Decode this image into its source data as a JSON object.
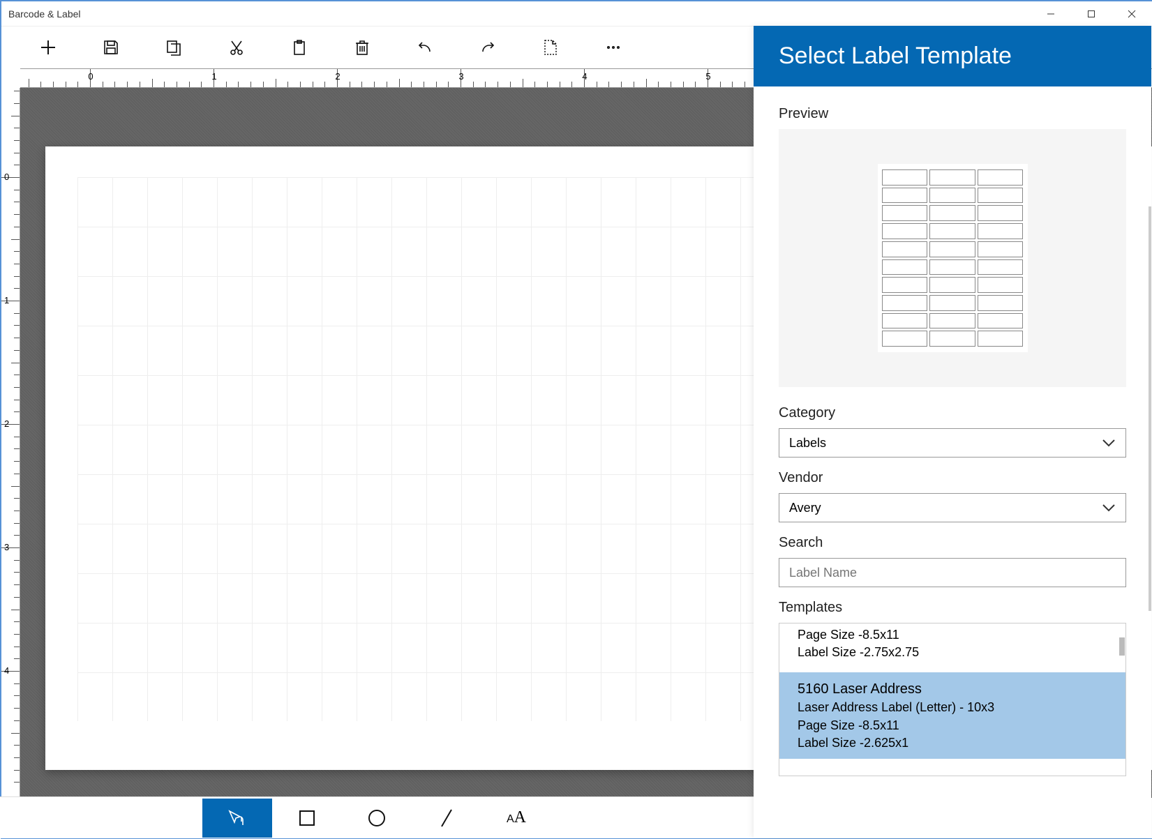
{
  "window": {
    "title": "Barcode & Label"
  },
  "toolbar": {
    "items": [
      "new",
      "save",
      "copy",
      "cut",
      "paste",
      "delete",
      "undo",
      "redo",
      "new-doc",
      "more"
    ]
  },
  "ruler": {
    "majors": [
      0,
      1,
      2,
      3,
      4,
      5
    ],
    "pxPerUnit": 177,
    "origin": 100
  },
  "vruler": {
    "majors": [
      0,
      1,
      2,
      3,
      4
    ],
    "pxPerUnit": 177,
    "origin": 128
  },
  "bottomTools": [
    "pointer",
    "rectangle",
    "circle",
    "line",
    "text"
  ],
  "panel": {
    "title": "Select Label Template",
    "previewLabel": "Preview",
    "categoryLabel": "Category",
    "categoryValue": "Labels",
    "vendorLabel": "Vendor",
    "vendorValue": "Avery",
    "searchLabel": "Search",
    "searchPlaceholder": "Label Name",
    "templatesLabel": "Templates",
    "templates": [
      {
        "name": "",
        "desc": "",
        "page": "Page Size -8.5x11",
        "label": "Label Size -2.75x2.75",
        "selected": false
      },
      {
        "name": "5160 Laser Address",
        "desc": "Laser Address Label (Letter) - 10x3",
        "page": "Page Size -8.5x11",
        "label": "Label Size -2.625x1",
        "selected": true
      }
    ]
  }
}
